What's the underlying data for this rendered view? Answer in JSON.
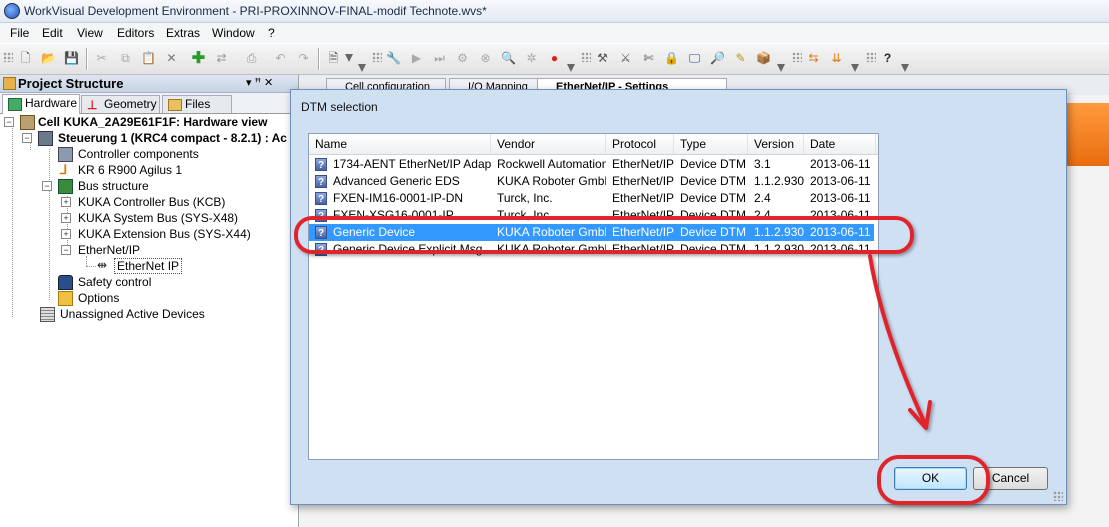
{
  "window": {
    "title": "WorkVisual Development Environment - PRI-PROXINNOV-FINAL-modif Technote.wvs*"
  },
  "menu": [
    "File",
    "Edit",
    "View",
    "Editors",
    "Extras",
    "Window",
    "?"
  ],
  "left_panel": {
    "title": "Project Structure",
    "pin_label": "▾ ꟸ ✕",
    "tabs": [
      "Hardware",
      "Geometry",
      "Files"
    ],
    "tree": {
      "cell": "Cell KUKA_2A29E61F1F: Hardware view",
      "controller": "Steuerung 1 (KRC4 compact - 8.2.1) : Ac",
      "controller_components": "Controller components",
      "robot": "KR 6 R900 Agilus 1",
      "bus_structure": "Bus structure",
      "kcb": "KUKA Controller Bus (KCB)",
      "sys_x48": "KUKA System Bus (SYS-X48)",
      "sys_x44": "KUKA Extension Bus (SYS-X44)",
      "ethernet_ip": "EtherNet/IP",
      "ethernet_ip_device": "EtherNet IP",
      "safety": "Safety control",
      "options": "Options",
      "unassigned": "Unassigned Active Devices"
    }
  },
  "editor_tabs": [
    "Cell configuration",
    "I/O Mapping",
    "EtherNet/IP - Settings"
  ],
  "dialog": {
    "title": "DTM selection",
    "columns": [
      "Name",
      "Vendor",
      "Protocol",
      "Type",
      "Version",
      "Date"
    ],
    "rows": [
      {
        "name": "1734-AENT EtherNet/IP Adapter",
        "vendor": "Rockwell Automation",
        "protocol": "EtherNet/IP",
        "type": "Device DTM",
        "version": "3.1",
        "date": "2013-06-11"
      },
      {
        "name": "Advanced Generic EDS",
        "vendor": "KUKA Roboter GmbH",
        "protocol": "EtherNet/IP",
        "type": "Device DTM",
        "version": "1.1.2.930",
        "date": "2013-06-11"
      },
      {
        "name": "FXEN-IM16-0001-IP-DN",
        "vendor": "Turck, Inc.",
        "protocol": "EtherNet/IP",
        "type": "Device DTM",
        "version": "2.4",
        "date": "2013-06-11"
      },
      {
        "name": "FXEN-XSG16-0001-IP",
        "vendor": "Turck, Inc.",
        "protocol": "EtherNet/IP",
        "type": "Device DTM",
        "version": "2.4",
        "date": "2013-06-11"
      },
      {
        "name": "Generic Device",
        "vendor": "KUKA Roboter GmbH",
        "protocol": "EtherNet/IP",
        "type": "Device DTM",
        "version": "1.1.2.930",
        "date": "2013-06-11"
      },
      {
        "name": "Generic Device Explicit Msg",
        "vendor": "KUKA Roboter GmbH",
        "protocol": "EtherNet/IP",
        "type": "Device DTM",
        "version": "1.1.2.930",
        "date": "2013-06-11"
      }
    ],
    "selected_index": 4,
    "ok_label": "OK",
    "cancel_label": "Cancel"
  },
  "colors": {
    "selection": "#3399ff",
    "annotation": "#e0242c",
    "dialog_bg": "#cfe0f3"
  }
}
